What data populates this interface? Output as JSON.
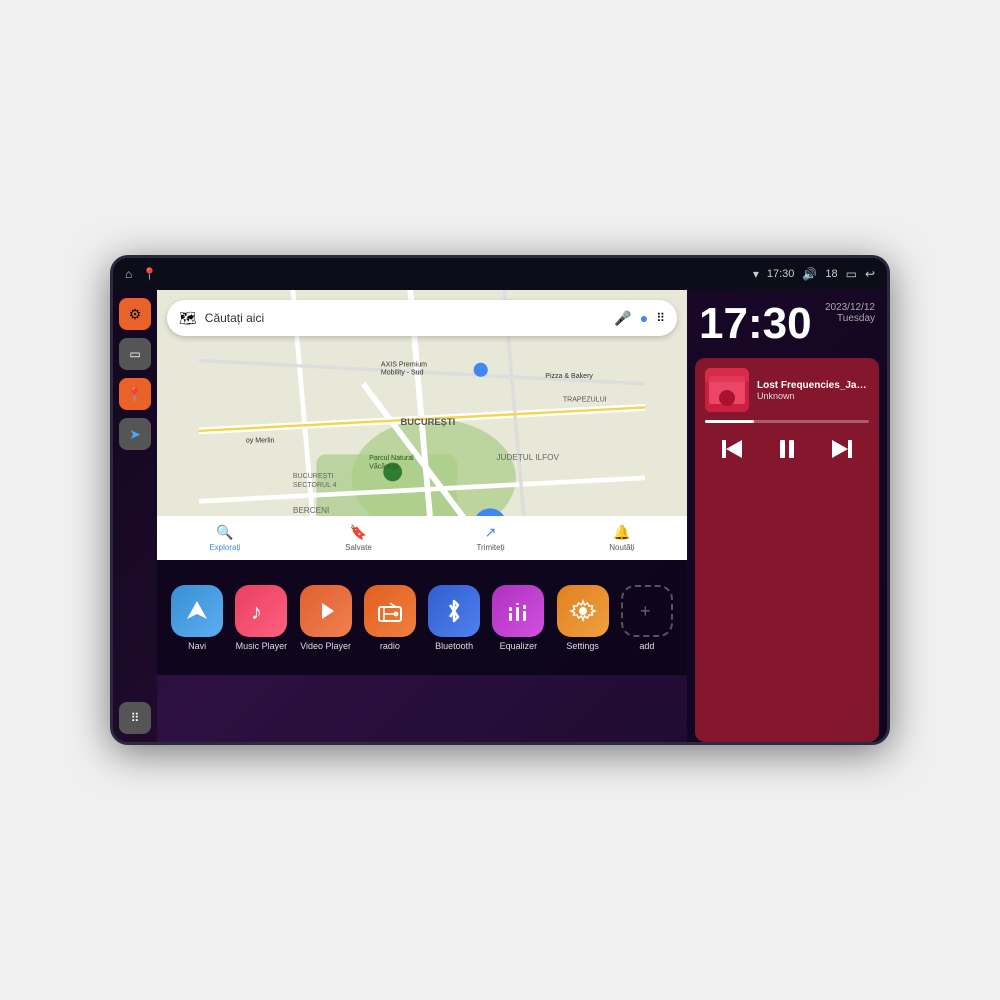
{
  "device": {
    "status_bar": {
      "left_icons": [
        "home",
        "maps"
      ],
      "time": "17:30",
      "signal": "wifi",
      "volume": "18",
      "battery": "battery",
      "back": "back"
    }
  },
  "clock": {
    "time": "17:30",
    "date": "2023/12/12",
    "day": "Tuesday"
  },
  "music": {
    "track_name": "Lost Frequencies_Janie...",
    "artist": "Unknown",
    "progress": 30
  },
  "map": {
    "search_placeholder": "Căutați aici",
    "areas": [
      "BUCUREȘTI",
      "BUCUREȘTI SECTORUL 4",
      "BERCENI",
      "JUDEȚUL ILFOV",
      "TRAPEZULUI"
    ],
    "poi": [
      "AXIS Premium Mobility - Sud",
      "Pizza & Bakery",
      "Parcul Natural Văcărești",
      "oy Merlin"
    ],
    "bottom_items": [
      {
        "icon": "🔍",
        "label": "Explorați"
      },
      {
        "icon": "🔖",
        "label": "Salvate"
      },
      {
        "icon": "↗",
        "label": "Trimiteți"
      },
      {
        "icon": "🔔",
        "label": "Noutăți"
      }
    ]
  },
  "sidebar": {
    "icons": [
      {
        "name": "settings",
        "color": "orange",
        "symbol": "⚙"
      },
      {
        "name": "folder",
        "color": "gray",
        "symbol": "▭"
      },
      {
        "name": "maps",
        "color": "orange",
        "symbol": "📍"
      },
      {
        "name": "navigation",
        "color": "gray",
        "symbol": "➤"
      },
      {
        "name": "grid",
        "color": "gray",
        "symbol": "⠿"
      }
    ]
  },
  "apps": [
    {
      "id": "navi",
      "label": "Navi",
      "icon": "➤",
      "bg": "navi-bg"
    },
    {
      "id": "music-player",
      "label": "Music Player",
      "icon": "♪",
      "bg": "music-bg"
    },
    {
      "id": "video-player",
      "label": "Video Player",
      "icon": "▶",
      "bg": "video-bg"
    },
    {
      "id": "radio",
      "label": "radio",
      "icon": "📻",
      "bg": "radio-bg"
    },
    {
      "id": "bluetooth",
      "label": "Bluetooth",
      "icon": "⚡",
      "bg": "bt-bg"
    },
    {
      "id": "equalizer",
      "label": "Equalizer",
      "icon": "≡",
      "bg": "eq-bg"
    },
    {
      "id": "settings",
      "label": "Settings",
      "icon": "⚙",
      "bg": "settings-bg"
    },
    {
      "id": "add",
      "label": "add",
      "icon": "+",
      "bg": "add-bg"
    }
  ],
  "controls": {
    "prev": "⏮",
    "pause": "⏸",
    "next": "⏭"
  }
}
